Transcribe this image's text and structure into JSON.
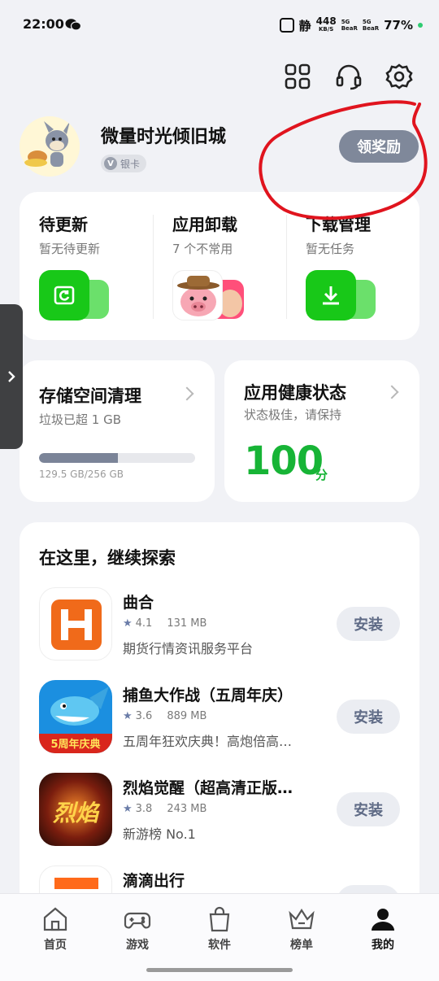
{
  "status": {
    "time": "22:00",
    "indicator": "静",
    "speed_value": "448",
    "speed_unit": "KB/S",
    "sim1": "5G",
    "sim1_sub": "BeaR",
    "sim2": "5G",
    "sim2_sub": "BeaR",
    "battery": "77%"
  },
  "top_icons": [
    "apps-grid-icon",
    "headset-icon",
    "settings-gear-icon"
  ],
  "profile": {
    "name": "微量时光倾旧城",
    "badge": "银卡",
    "reward_button": "领奖励"
  },
  "quick": [
    {
      "title": "待更新",
      "subtitle": "暂无待更新",
      "icon": "update-icon"
    },
    {
      "title": "应用卸载",
      "subtitle": "7 个不常用",
      "icon": "app-avatars"
    },
    {
      "title": "下载管理",
      "subtitle": "暂无任务",
      "icon": "download-icon"
    }
  ],
  "storage": {
    "title": "存储空间清理",
    "subtitle": "垃圾已超 1 GB",
    "usage_text": "129.5 GB/256 GB",
    "used_fraction": 0.506
  },
  "health": {
    "title": "应用健康状态",
    "subtitle": "状态极佳，请保持",
    "score": "100",
    "unit": "分"
  },
  "explore": {
    "title": "在这里，继续探索",
    "install_label": "安装",
    "apps": [
      {
        "name": "曲合",
        "rating": "4.1",
        "size": "131 MB",
        "desc": "期货行情资讯服务平台"
      },
      {
        "name": "捕鱼大作战（五周年庆）",
        "rating": "3.6",
        "size": "889 MB",
        "desc": "五周年狂欢庆典！高炮倍高…"
      },
      {
        "name": "烈焰觉醒（超高清正版…",
        "rating": "3.8",
        "size": "243 MB",
        "desc": "新游榜 No.1"
      },
      {
        "name": "滴滴出行",
        "rating": "",
        "size": "",
        "desc": ""
      }
    ],
    "fish_icon_text": "5周年庆典",
    "fire_icon_text": "烈焰"
  },
  "nav": [
    {
      "label": "首页",
      "icon": "home-icon"
    },
    {
      "label": "游戏",
      "icon": "gamepad-icon"
    },
    {
      "label": "软件",
      "icon": "shopping-bag-icon"
    },
    {
      "label": "榜单",
      "icon": "crown-icon"
    },
    {
      "label": "我的",
      "icon": "person-icon",
      "active": true
    }
  ],
  "colors": {
    "accent_green": "#17b436",
    "reward_button": "#7f889a",
    "annotation_red": "#e0141e"
  }
}
